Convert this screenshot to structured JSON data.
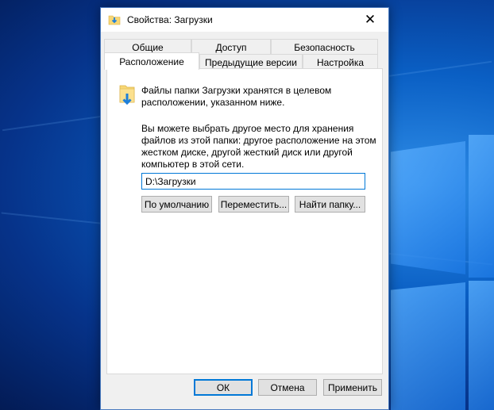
{
  "window": {
    "title": "Свойства: Загрузки",
    "close_glyph": "✕"
  },
  "tabs_row_back": [
    {
      "label": "Общие"
    },
    {
      "label": "Доступ"
    },
    {
      "label": "Безопасность"
    }
  ],
  "tabs_row_front": [
    {
      "label": "Расположение",
      "active": true
    },
    {
      "label": "Предыдущие версии"
    },
    {
      "label": "Настройка"
    }
  ],
  "location_tab": {
    "info_line1": "Файлы папки Загрузки хранятся в целевом",
    "info_line2": "расположении, указанном ниже.",
    "desc_line1": "Вы можете выбрать другое место для хранения",
    "desc_line2": "файлов из этой папки: другое расположение на этом",
    "desc_line3": "жестком диске, другой жесткий диск или другой",
    "desc_line4": "компьютер в этой сети.",
    "path_value": "D:\\Загрузки",
    "restore_default_label": "По умолчанию",
    "move_label": "Переместить...",
    "find_folder_label": "Найти папку..."
  },
  "footer": {
    "ok_label": "ОК",
    "cancel_label": "Отмена",
    "apply_label": "Применить"
  },
  "colors": {
    "accent": "#0078d7",
    "dialog_bg": "#f0f0f0",
    "folder_yellow": "#f8d775",
    "arrow_blue": "#1e7fd9"
  }
}
